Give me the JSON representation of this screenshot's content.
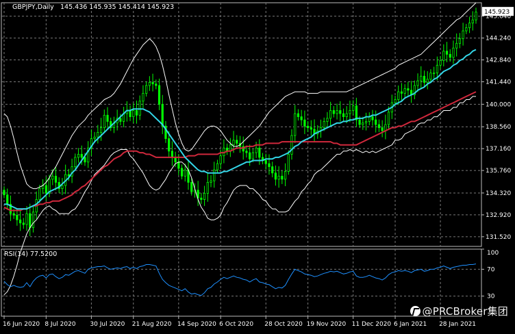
{
  "header": {
    "symbol": "GBPJPY,Daily",
    "ohlc": "145.436 145.935 145.414 145.923",
    "rsi_label": "RSI(14) 77.5200"
  },
  "watermark": "@PRCBroker集团",
  "colors": {
    "background": "#000000",
    "grid": "#7a7a7a",
    "candle": "#00ff00",
    "bollinger": "#ffffff",
    "sma_fast": "#33d6e8",
    "sma_slow": "#d0283c",
    "rsi": "#1e90ff",
    "price_tag_bg": "#ffffff"
  },
  "chart_data": [
    {
      "type": "candlestick",
      "title": "GBPJPY,Daily",
      "x_tick_labels": [
        "16 Jun 2020",
        "8 Jul 2020",
        "30 Jul 2020",
        "21 Aug 2020",
        "14 Sep 2020",
        "6 Oct 2020",
        "28 Oct 2020",
        "19 Nov 2020",
        "11 Dec 2020",
        "6 Jan 2021",
        "28 Jan 2021"
      ],
      "y_tick_labels": [
        "145.640",
        "144.240",
        "142.840",
        "141.440",
        "140.000",
        "138.560",
        "137.160",
        "135.760",
        "134.320",
        "132.920",
        "131.520"
      ],
      "ylim": [
        130.9,
        146.5
      ],
      "last_price": "145.923",
      "grid": true,
      "close_by_day": [
        134.2,
        133.6,
        133.0,
        132.9,
        132.6,
        132.4,
        132.3,
        133.0,
        132.1,
        133.1,
        133.9,
        134.6,
        134.8,
        134.3,
        135.2,
        135.4,
        135.0,
        134.6,
        134.8,
        135.5,
        135.4,
        136.0,
        136.6,
        136.8,
        136.6,
        136.3,
        137.2,
        137.8,
        137.9,
        138.2,
        138.5,
        139.3,
        138.9,
        138.5,
        138.8,
        139.1,
        138.9,
        139.4,
        139.6,
        139.2,
        139.6,
        139.3,
        140.2,
        140.7,
        141.2,
        141.4,
        141.3,
        141.2,
        140.0,
        138.6,
        137.8,
        137.0,
        136.6,
        136.3,
        135.9,
        135.4,
        135.8,
        135.0,
        134.4,
        134.5,
        134.0,
        133.9,
        134.3,
        135.0,
        135.1,
        135.8,
        136.2,
        136.7,
        137.2,
        137.0,
        137.4,
        137.7,
        137.5,
        137.3,
        137.0,
        136.9,
        136.5,
        136.9,
        137.2,
        136.6,
        136.4,
        136.2,
        136.0,
        135.6,
        135.2,
        135.4,
        135.2,
        135.7,
        136.8,
        138.0,
        139.4,
        139.2,
        139.0,
        138.6,
        138.5,
        138.4,
        138.1,
        138.3,
        138.5,
        138.9,
        139.1,
        139.6,
        139.4,
        139.6,
        139.4,
        139.2,
        139.4,
        139.6,
        139.9,
        139.0,
        138.7,
        138.8,
        138.9,
        139.2,
        139.0,
        138.7,
        138.5,
        138.3,
        138.7,
        139.5,
        140.1,
        140.3,
        140.8,
        140.7,
        141.0,
        140.9,
        140.6,
        141.2,
        141.5,
        141.8,
        141.4,
        141.6,
        142.0,
        142.0,
        142.5,
        142.8,
        143.4,
        143.2,
        143.0,
        143.6,
        143.9,
        144.2,
        144.7,
        144.9,
        145.2,
        145.4,
        145.9
      ],
      "sma_fast_by_day": [
        133.6,
        133.6,
        133.5,
        133.4,
        133.3,
        133.3,
        133.3,
        133.3,
        133.4,
        133.5,
        133.6,
        133.8,
        134.0,
        134.2,
        134.4,
        134.5,
        134.6,
        134.7,
        134.9,
        135.1,
        135.3,
        135.6,
        135.8,
        136.1,
        136.4,
        136.7,
        137.0,
        137.3,
        137.6,
        137.8,
        138.0,
        138.2,
        138.4,
        138.6,
        138.8,
        139.0,
        139.2,
        139.4,
        139.6,
        139.6,
        139.7,
        139.7,
        139.7,
        139.7,
        139.6,
        139.5,
        139.3,
        139.1,
        138.9,
        138.7,
        138.4,
        138.1,
        137.8,
        137.5,
        137.2,
        136.9,
        136.6,
        136.4,
        136.2,
        136.0,
        135.8,
        135.7,
        135.7,
        135.6,
        135.6,
        135.6,
        135.6,
        135.6,
        135.7,
        135.7,
        135.8,
        135.9,
        136.0,
        136.1,
        136.2,
        136.3,
        136.3,
        136.4,
        136.4,
        136.4,
        136.4,
        136.5,
        136.5,
        136.5,
        136.6,
        136.6,
        136.7,
        136.8,
        136.9,
        137.1,
        137.3,
        137.4,
        137.6,
        137.7,
        137.8,
        137.9,
        138.1,
        138.2,
        138.3,
        138.4,
        138.5,
        138.6,
        138.7,
        138.8,
        138.8,
        138.9,
        138.9,
        139.0,
        139.0,
        139.1,
        139.1,
        139.1,
        139.2,
        139.2,
        139.3,
        139.3,
        139.4,
        139.5,
        139.6,
        139.7,
        139.8,
        140.0,
        140.1,
        140.2,
        140.4,
        140.5,
        140.6,
        140.7,
        140.9,
        141.0,
        141.1,
        141.3,
        141.4,
        141.6,
        141.7,
        141.9,
        142.1,
        142.2,
        142.3,
        142.5,
        142.6,
        142.8,
        142.9,
        143.1,
        143.2,
        143.4,
        143.5
      ],
      "sma_slow_by_day": [
        133.4,
        133.3,
        133.2,
        133.2,
        133.2,
        133.2,
        133.3,
        133.3,
        133.4,
        133.5,
        133.5,
        133.6,
        133.6,
        133.7,
        133.7,
        133.8,
        133.8,
        133.8,
        133.9,
        134.0,
        134.1,
        134.2,
        134.4,
        134.5,
        134.7,
        134.8,
        135.0,
        135.2,
        135.4,
        135.6,
        135.8,
        136.0,
        136.1,
        136.3,
        136.5,
        136.6,
        136.7,
        136.9,
        137.0,
        137.0,
        137.0,
        137.0,
        136.9,
        136.9,
        136.8,
        136.8,
        136.7,
        136.6,
        136.6,
        136.6,
        136.6,
        136.6,
        136.6,
        136.6,
        136.6,
        136.6,
        136.6,
        136.7,
        136.7,
        136.7,
        136.8,
        136.8,
        136.8,
        136.8,
        136.8,
        136.8,
        136.8,
        136.9,
        136.9,
        137.0,
        137.0,
        137.1,
        137.2,
        137.2,
        137.2,
        137.3,
        137.3,
        137.3,
        137.4,
        137.4,
        137.4,
        137.5,
        137.5,
        137.5,
        137.5,
        137.5,
        137.6,
        137.6,
        137.6,
        137.6,
        137.6,
        137.6,
        137.6,
        137.6,
        137.6,
        137.6,
        137.6,
        137.6,
        137.6,
        137.6,
        137.6,
        137.6,
        137.5,
        137.5,
        137.4,
        137.4,
        137.4,
        137.4,
        137.4,
        137.4,
        137.5,
        137.6,
        137.7,
        137.8,
        137.9,
        138.0,
        138.1,
        138.2,
        138.3,
        138.4,
        138.5,
        138.5,
        138.6,
        138.6,
        138.7,
        138.8,
        138.9,
        138.9,
        139.0,
        139.1,
        139.2,
        139.3,
        139.4,
        139.5,
        139.6,
        139.7,
        139.8,
        139.9,
        140.0,
        140.1,
        140.2,
        140.3,
        140.4,
        140.5,
        140.6,
        140.7,
        140.8
      ],
      "bollinger_upper_by_day": [
        139.4,
        139.2,
        138.6,
        137.8,
        136.9,
        136.1,
        135.5,
        134.9,
        134.7,
        134.6,
        134.6,
        134.7,
        134.8,
        135.0,
        135.3,
        135.7,
        136.0,
        136.4,
        136.8,
        137.2,
        137.6,
        138.0,
        138.3,
        138.6,
        138.8,
        139.0,
        139.3,
        139.5,
        139.7,
        139.9,
        140.1,
        140.3,
        140.4,
        140.5,
        140.7,
        141.0,
        141.3,
        141.7,
        142.1,
        142.5,
        142.9,
        143.2,
        143.5,
        143.8,
        144.0,
        144.2,
        144.0,
        143.7,
        143.2,
        142.5,
        141.6,
        140.6,
        139.7,
        138.8,
        138.1,
        137.5,
        137.1,
        137.0,
        137.1,
        137.4,
        137.7,
        138.0,
        138.3,
        138.5,
        138.6,
        138.6,
        138.5,
        138.3,
        138.0,
        137.7,
        137.5,
        137.3,
        137.3,
        137.4,
        137.6,
        137.8,
        138.0,
        138.2,
        138.4,
        138.6,
        138.9,
        139.2,
        139.5,
        139.7,
        139.9,
        140.1,
        140.3,
        140.5,
        140.6,
        140.7,
        140.8,
        140.8,
        140.8,
        140.8,
        140.7,
        140.7,
        140.7,
        140.7,
        140.8,
        140.8,
        140.8,
        140.8,
        140.8,
        140.8,
        140.8,
        140.8,
        140.8,
        140.9,
        141.0,
        141.1,
        141.2,
        141.3,
        141.4,
        141.5,
        141.6,
        141.7,
        141.8,
        141.9,
        142.0,
        142.1,
        142.2,
        142.3,
        142.5,
        142.6,
        142.7,
        142.8,
        142.9,
        143.0,
        143.1,
        143.2,
        143.4,
        143.6,
        143.8,
        144.0,
        144.2,
        144.4,
        144.6,
        144.8,
        145.0,
        145.2,
        145.4,
        145.5,
        145.7,
        145.9,
        146.1,
        146.3,
        146.5
      ],
      "bollinger_lower_by_day": [
        127.8,
        128.0,
        128.4,
        129.0,
        129.7,
        130.5,
        131.1,
        131.7,
        132.1,
        132.4,
        132.6,
        132.9,
        133.2,
        133.4,
        133.5,
        133.3,
        133.2,
        133.0,
        133.0,
        133.0,
        133.0,
        133.2,
        133.3,
        133.6,
        134.0,
        134.4,
        134.7,
        135.1,
        135.5,
        135.7,
        135.9,
        136.1,
        136.4,
        136.7,
        136.9,
        137.0,
        137.1,
        137.1,
        137.1,
        136.7,
        136.5,
        136.2,
        135.9,
        135.6,
        135.2,
        134.8,
        134.6,
        134.5,
        134.6,
        134.9,
        135.2,
        135.6,
        135.9,
        136.2,
        136.3,
        136.3,
        136.1,
        135.8,
        135.3,
        134.6,
        133.9,
        133.4,
        133.1,
        132.7,
        132.6,
        132.6,
        132.7,
        132.9,
        133.4,
        133.7,
        134.1,
        134.5,
        134.7,
        134.8,
        134.8,
        134.8,
        134.6,
        134.6,
        134.4,
        134.2,
        133.9,
        133.8,
        133.5,
        133.3,
        133.3,
        133.1,
        133.1,
        133.1,
        133.2,
        133.5,
        133.8,
        134.0,
        134.4,
        134.6,
        134.9,
        135.1,
        135.5,
        135.7,
        135.8,
        136.0,
        136.2,
        136.4,
        136.6,
        136.8,
        136.8,
        137.0,
        137.0,
        137.1,
        137.0,
        137.1,
        137.0,
        136.9,
        137.0,
        136.9,
        137.0,
        136.9,
        137.0,
        137.1,
        137.2,
        137.3,
        137.4,
        137.7,
        137.7,
        137.8,
        138.1,
        138.2,
        138.3,
        138.4,
        138.7,
        138.8,
        138.8,
        139.0,
        139.0,
        139.2,
        139.2,
        139.4,
        139.6,
        139.6,
        139.6,
        139.8,
        139.8,
        140.1,
        140.1,
        140.3,
        140.3,
        140.5,
        140.5
      ]
    },
    {
      "type": "line",
      "title": "RSI(14) 77.5200",
      "y_tick_labels": [
        "100",
        "70",
        "30"
      ],
      "ylim": [
        0,
        100
      ],
      "values_by_day": [
        52,
        47,
        44,
        46,
        44,
        43,
        44,
        50,
        44,
        52,
        57,
        60,
        61,
        57,
        62,
        63,
        59,
        56,
        58,
        62,
        61,
        64,
        67,
        68,
        66,
        64,
        70,
        72,
        73,
        74,
        74,
        75,
        72,
        70,
        71,
        72,
        71,
        73,
        74,
        71,
        73,
        71,
        74,
        75,
        77,
        77,
        76,
        75,
        64,
        55,
        50,
        46,
        44,
        42,
        40,
        38,
        41,
        36,
        33,
        34,
        32,
        31,
        35,
        41,
        43,
        48,
        51,
        55,
        58,
        56,
        58,
        60,
        58,
        57,
        55,
        54,
        51,
        54,
        56,
        51,
        50,
        48,
        47,
        44,
        41,
        43,
        42,
        46,
        55,
        63,
        70,
        68,
        66,
        63,
        62,
        61,
        59,
        60,
        62,
        64,
        65,
        67,
        66,
        67,
        65,
        63,
        64,
        66,
        67,
        60,
        58,
        58,
        59,
        61,
        59,
        57,
        56,
        54,
        57,
        62,
        65,
        66,
        68,
        67,
        68,
        67,
        65,
        68,
        69,
        70,
        67,
        68,
        70,
        70,
        72,
        73,
        75,
        73,
        71,
        73,
        74,
        75,
        76,
        76,
        77,
        77,
        78
      ]
    }
  ]
}
